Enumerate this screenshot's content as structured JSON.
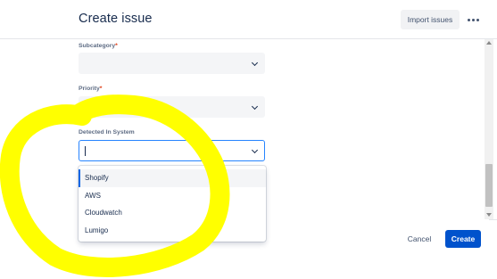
{
  "header": {
    "title": "Create issue",
    "import_label": "Import issues",
    "more_icon": "more-horizontal-icon"
  },
  "fields": {
    "subcategory": {
      "label": "Subcategory",
      "required_mark": "*",
      "value": ""
    },
    "priority": {
      "label": "Priority",
      "required_mark": "*",
      "value": ""
    },
    "detected_in_system": {
      "label": "Detected In System",
      "value": ""
    }
  },
  "dropdown": {
    "options": [
      "Shopify",
      "AWS",
      "Cloudwatch",
      "Lumigo"
    ],
    "highlighted_index": 0
  },
  "footer": {
    "cancel_label": "Cancel",
    "create_label": "Create"
  },
  "colors": {
    "primary": "#0052cc",
    "focus_border": "#2684ff",
    "required": "#de350b",
    "annotation": "#ffff00"
  }
}
